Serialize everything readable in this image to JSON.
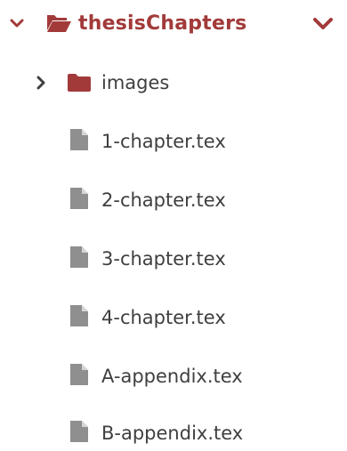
{
  "tree": {
    "root": {
      "label": "thesisChapters",
      "expanded": true,
      "color": "#a23a3a",
      "icon": "folder-open-icon"
    },
    "children": [
      {
        "type": "folder",
        "label": "images",
        "expanded": false,
        "icon": "folder-icon"
      },
      {
        "type": "file",
        "label": "1-chapter.tex",
        "icon": "file-icon"
      },
      {
        "type": "file",
        "label": "2-chapter.tex",
        "icon": "file-icon"
      },
      {
        "type": "file",
        "label": "3-chapter.tex",
        "icon": "file-icon"
      },
      {
        "type": "file",
        "label": "4-chapter.tex",
        "icon": "file-icon"
      },
      {
        "type": "file",
        "label": "A-appendix.tex",
        "icon": "file-icon"
      },
      {
        "type": "file",
        "label": "B-appendix.tex",
        "icon": "file-icon"
      }
    ]
  },
  "colors": {
    "accent": "#a23a3a",
    "text": "#3f3f3f",
    "file_icon": "#8f8f8f"
  }
}
